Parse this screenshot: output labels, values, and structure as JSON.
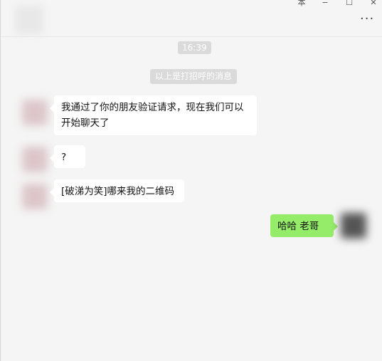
{
  "window_controls": {
    "pin": "本",
    "minimize": "−",
    "maximize": "☐",
    "close": "✕",
    "more": "···"
  },
  "chat": {
    "timestamp": "16:39",
    "system_tip": "以上是打招呼的消息",
    "messages": [
      {
        "side": "in",
        "text": "我通过了你的朋友验证请求，现在我们可以开始聊天了"
      },
      {
        "side": "in",
        "text": "?"
      },
      {
        "side": "in",
        "text": "[破涕为笑]哪来我的二维码"
      },
      {
        "side": "out",
        "text": "哈哈  老哥"
      }
    ]
  },
  "colors": {
    "background": "#f5f5f5",
    "incoming_bubble": "#ffffff",
    "outgoing_bubble": "#95ec69",
    "tip_bg": "#dadada"
  },
  "icons": [
    "pin-icon",
    "minimize-icon",
    "maximize-icon",
    "close-icon",
    "more-icon"
  ]
}
